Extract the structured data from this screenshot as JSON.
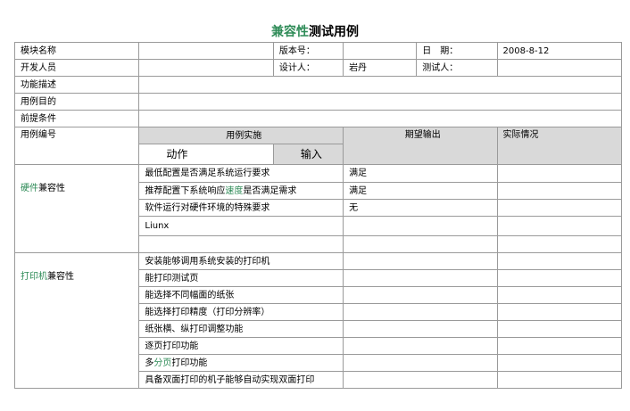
{
  "title": {
    "highlight": "兼容性",
    "rest": "测试用例"
  },
  "header": {
    "module_name_label": "模块名称",
    "version_label": "版本号：",
    "date_label": "日　期：",
    "date_value": "2008-8-12",
    "developer_label": "开发人员",
    "designer_label": "设计人：",
    "designer_value": "岩丹",
    "tester_label": "测试人：",
    "function_desc_label": "功能描述",
    "purpose_label": "用例目的",
    "precondition_label": "前提条件"
  },
  "columns": {
    "case_id": "用例编号",
    "implementation": "用例实施",
    "action": "动作",
    "input": "输入",
    "expected": "期望输出",
    "actual": "实际情况"
  },
  "groups": [
    {
      "name_green": "硬件",
      "name_rest": "兼容性",
      "rows": [
        {
          "action": "最低配置是否满足系统运行要求",
          "expected": "满足"
        },
        {
          "action_pre": "推荐配置下系统响应",
          "action_hl": "速度",
          "action_post": "是否满足需求",
          "expected": "满足"
        },
        {
          "action": "软件运行对硬件环境的特殊要求",
          "expected": "无"
        },
        {
          "action": "Liunx",
          "expected": ""
        },
        {
          "action": "",
          "expected": ""
        }
      ]
    },
    {
      "name_green": "打印机",
      "name_rest": "兼容性",
      "rows": [
        {
          "action": "安装能够调用系统安装的打印机"
        },
        {
          "action": "能打印测试页"
        },
        {
          "action": "能选择不同幅面的纸张"
        },
        {
          "action": "能选择打印精度（打印分辨率）"
        },
        {
          "action": "纸张横、纵打印调整功能"
        },
        {
          "action": "逐页打印功能"
        },
        {
          "action_pre": "多",
          "action_hl": "分页",
          "action_post": "打印功能"
        },
        {
          "action": "具备双面打印的机子能够自动实现双面打印"
        }
      ]
    }
  ]
}
